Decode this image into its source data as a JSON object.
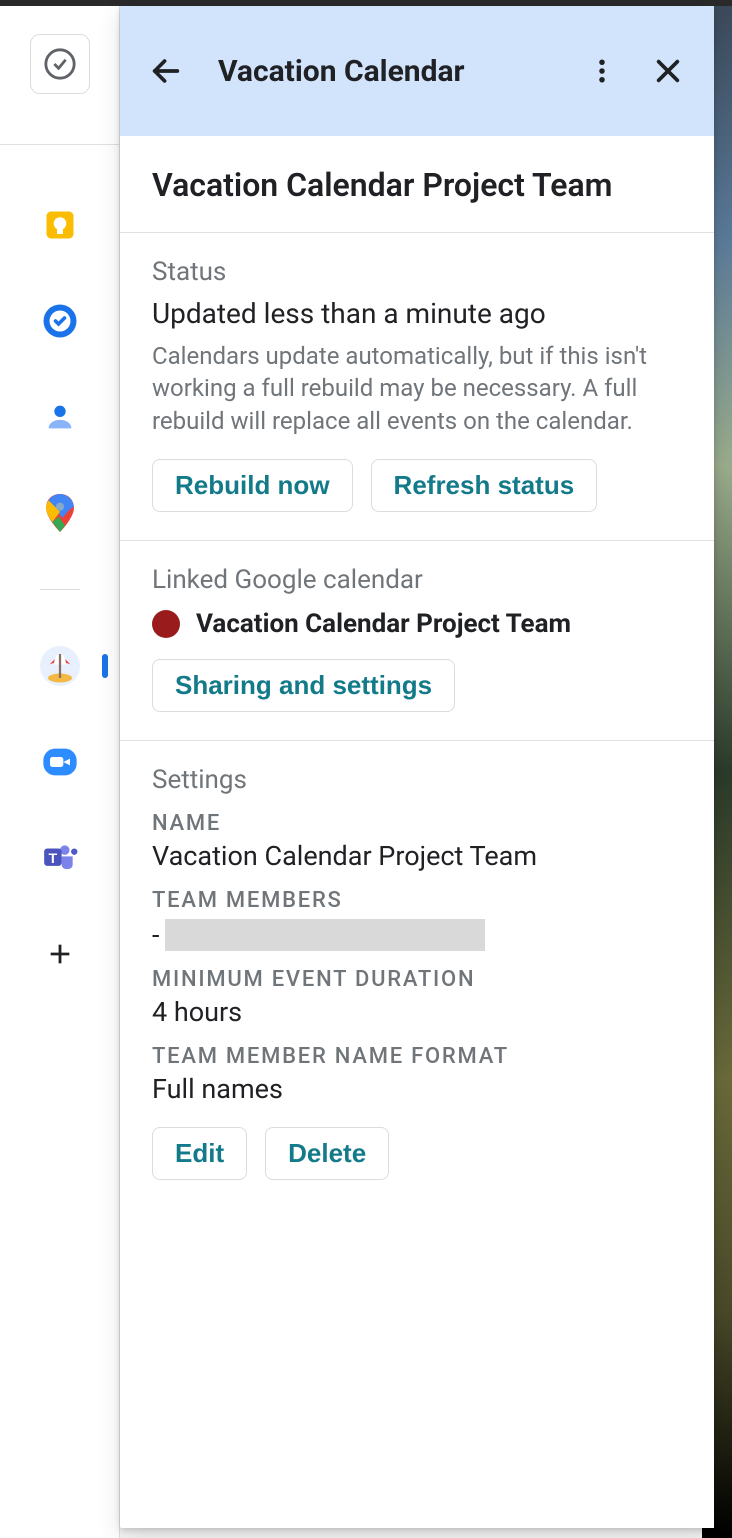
{
  "panel": {
    "header_title": "Vacation Calendar",
    "project_title": "Vacation Calendar Project Team"
  },
  "status": {
    "section_label": "Status",
    "updated_text": "Updated less than a minute ago",
    "description": "Calendars update automatically, but if this isn't working a full rebuild may be necessary. A full rebuild will replace all events on the calendar.",
    "rebuild_label": "Rebuild now",
    "refresh_label": "Refresh status"
  },
  "linked": {
    "section_label": "Linked Google calendar",
    "calendar_name": "Vacation Calendar Project Team",
    "dot_color": "#9a1b1b",
    "sharing_label": "Sharing and settings"
  },
  "settings": {
    "section_label": "Settings",
    "name_label": "NAME",
    "name_value": "Vacation Calendar Project Team",
    "members_label": "TEAM MEMBERS",
    "members_prefix": "-",
    "min_duration_label": "MINIMUM EVENT DURATION",
    "min_duration_value": "4 hours",
    "name_format_label": "TEAM MEMBER NAME FORMAT",
    "name_format_value": "Full names",
    "edit_label": "Edit",
    "delete_label": "Delete"
  },
  "sidebar": {
    "items": [
      {
        "id": "keep",
        "icon": "lightbulb"
      },
      {
        "id": "tasks",
        "icon": "tasks-checkmark"
      },
      {
        "id": "contacts",
        "icon": "person"
      },
      {
        "id": "maps",
        "icon": "maps-pin"
      },
      {
        "id": "vacation",
        "icon": "beach-umbrella",
        "active": true
      },
      {
        "id": "zoom",
        "icon": "camera"
      },
      {
        "id": "teams",
        "icon": "teams"
      },
      {
        "id": "add",
        "icon": "plus"
      }
    ]
  }
}
